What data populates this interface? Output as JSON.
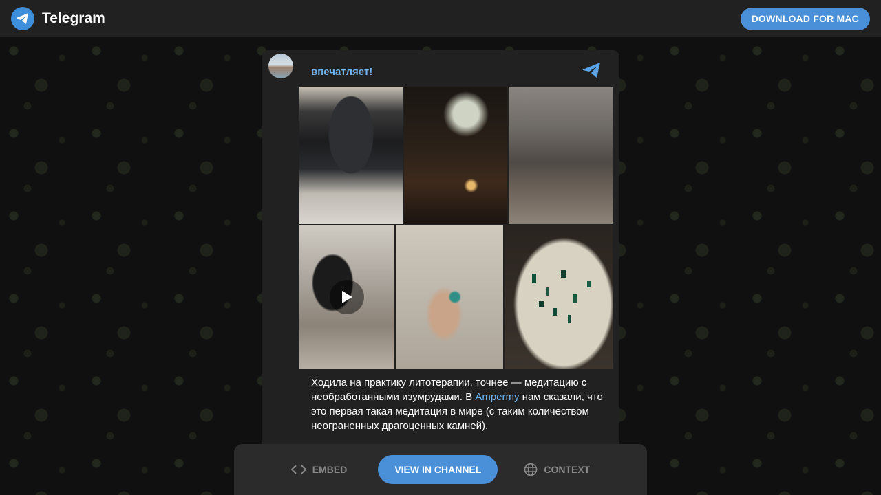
{
  "header": {
    "brand": "Telegram",
    "download_label": "DOWNLOAD FOR MAC"
  },
  "post": {
    "channel_name": "впечатляет!",
    "text_before_link": "Ходила на практику литотерапии, точнее — медитацию с необработанными изумрудами. В ",
    "link_text": "Ampermy",
    "text_after_link": " нам сказали, что это первая такая медитация в мире (с таким количеством неограненных драгоценных камней).",
    "media": [
      {
        "kind": "photo",
        "icon": "none"
      },
      {
        "kind": "photo",
        "icon": "none"
      },
      {
        "kind": "photo",
        "icon": "none"
      },
      {
        "kind": "video",
        "icon": "play-icon"
      },
      {
        "kind": "photo",
        "icon": "none"
      },
      {
        "kind": "photo",
        "icon": "none"
      }
    ]
  },
  "footer": {
    "embed_label": "EMBED",
    "view_label": "VIEW IN CHANNEL",
    "context_label": "CONTEXT"
  },
  "colors": {
    "accent": "#4a90d9",
    "link": "#6fb3ee",
    "topbar": "#212121",
    "card": "#212121"
  }
}
